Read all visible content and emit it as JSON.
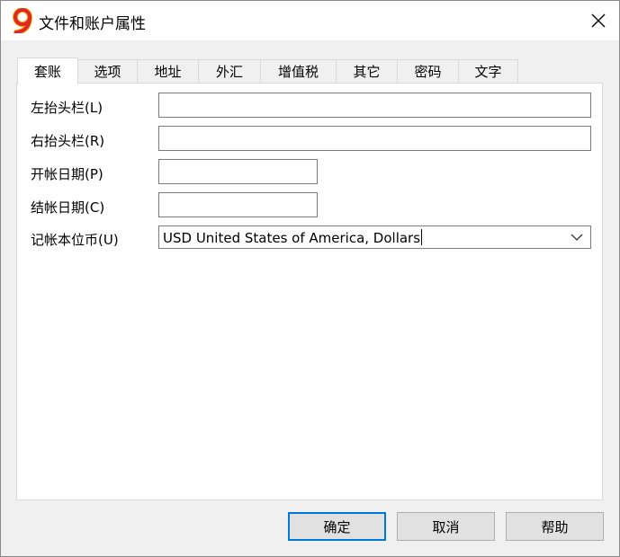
{
  "window": {
    "title": "文件和账户属性",
    "icon": "app-logo-icon",
    "close_icon": "close-icon"
  },
  "tabs": [
    {
      "label": "套账",
      "active": true
    },
    {
      "label": "选项",
      "active": false
    },
    {
      "label": "地址",
      "active": false
    },
    {
      "label": "外汇",
      "active": false
    },
    {
      "label": "增值税",
      "active": false
    },
    {
      "label": "其它",
      "active": false
    },
    {
      "label": "密码",
      "active": false
    },
    {
      "label": "文字",
      "active": false
    }
  ],
  "form": {
    "left_header": {
      "label": "左抬头栏(L)",
      "value": ""
    },
    "right_header": {
      "label": "右抬头栏(R)",
      "value": ""
    },
    "opening_date": {
      "label": "开帐日期(P)",
      "value": ""
    },
    "closing_date": {
      "label": "结帐日期(C)",
      "value": ""
    },
    "base_currency": {
      "label": "记帐本位币(U)",
      "value": "USD United States of America, Dollars"
    }
  },
  "buttons": {
    "ok": "确定",
    "cancel": "取消",
    "help": "帮助"
  },
  "colors": {
    "window_bg": "#f0f0f0",
    "panel_bg": "#ffffff",
    "accent": "#0078d7",
    "logo_red": "#e0262b",
    "logo_yellow": "#f2b705"
  }
}
